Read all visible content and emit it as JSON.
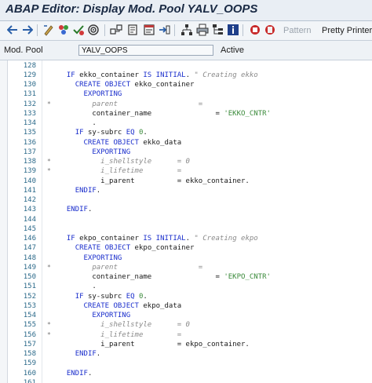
{
  "window": {
    "title": "ABAP Editor: Display Mod. Pool YALV_OOPS"
  },
  "toolbar": {
    "pattern_label": "Pattern",
    "pretty_printer_label": "Pretty Printer"
  },
  "infobar": {
    "label": "Mod. Pool",
    "program": "YALV_OOPS",
    "status": "Active"
  },
  "code_lines": [
    {
      "num": "128",
      "marker": "",
      "segments": []
    },
    {
      "num": "129",
      "marker": "",
      "segments": [
        {
          "t": "  "
        },
        {
          "t": "IF",
          "c": "kw"
        },
        {
          "t": " ekko_container "
        },
        {
          "t": "IS INITIAL",
          "c": "kw"
        },
        {
          "t": ". "
        },
        {
          "t": "\" Creating ekko",
          "c": "cm"
        }
      ]
    },
    {
      "num": "130",
      "marker": "",
      "segments": [
        {
          "t": "    "
        },
        {
          "t": "CREATE OBJECT",
          "c": "kw"
        },
        {
          "t": " ekko_container"
        }
      ]
    },
    {
      "num": "131",
      "marker": "",
      "segments": [
        {
          "t": "      "
        },
        {
          "t": "EXPORTING",
          "c": "kw"
        }
      ]
    },
    {
      "num": "132",
      "marker": "*",
      "segments": [
        {
          "t": "        parent                   =",
          "c": "cm"
        }
      ]
    },
    {
      "num": "133",
      "marker": "",
      "segments": [
        {
          "t": "        container_name               = "
        },
        {
          "t": "'EKKO_CNTR'",
          "c": "st"
        }
      ]
    },
    {
      "num": "134",
      "marker": "",
      "segments": [
        {
          "t": "        ."
        }
      ]
    },
    {
      "num": "135",
      "marker": "",
      "segments": [
        {
          "t": "    "
        },
        {
          "t": "IF",
          "c": "kw"
        },
        {
          "t": " sy-subrc "
        },
        {
          "t": "EQ",
          "c": "kw"
        },
        {
          "t": " "
        },
        {
          "t": "0",
          "c": "st"
        },
        {
          "t": "."
        }
      ]
    },
    {
      "num": "136",
      "marker": "",
      "segments": [
        {
          "t": "      "
        },
        {
          "t": "CREATE OBJECT",
          "c": "kw"
        },
        {
          "t": " ekko_data"
        }
      ]
    },
    {
      "num": "137",
      "marker": "",
      "segments": [
        {
          "t": "        "
        },
        {
          "t": "EXPORTING",
          "c": "kw"
        }
      ]
    },
    {
      "num": "138",
      "marker": "*",
      "segments": [
        {
          "t": "          i_shellstyle      = 0",
          "c": "cm"
        }
      ]
    },
    {
      "num": "139",
      "marker": "*",
      "segments": [
        {
          "t": "          i_lifetime        =",
          "c": "cm"
        }
      ]
    },
    {
      "num": "140",
      "marker": "",
      "segments": [
        {
          "t": "          i_parent          = ekko_container."
        }
      ]
    },
    {
      "num": "141",
      "marker": "",
      "segments": [
        {
          "t": "    "
        },
        {
          "t": "ENDIF",
          "c": "kw"
        },
        {
          "t": "."
        }
      ]
    },
    {
      "num": "142",
      "marker": "",
      "segments": []
    },
    {
      "num": "143",
      "marker": "",
      "segments": [
        {
          "t": "  "
        },
        {
          "t": "ENDIF",
          "c": "kw"
        },
        {
          "t": "."
        }
      ]
    },
    {
      "num": "144",
      "marker": "",
      "segments": []
    },
    {
      "num": "145",
      "marker": "",
      "segments": []
    },
    {
      "num": "146",
      "marker": "",
      "segments": [
        {
          "t": "  "
        },
        {
          "t": "IF",
          "c": "kw"
        },
        {
          "t": " ekpo_container "
        },
        {
          "t": "IS INITIAL",
          "c": "kw"
        },
        {
          "t": ". "
        },
        {
          "t": "\" Creating ekpo",
          "c": "cm"
        }
      ]
    },
    {
      "num": "147",
      "marker": "",
      "segments": [
        {
          "t": "    "
        },
        {
          "t": "CREATE OBJECT",
          "c": "kw"
        },
        {
          "t": " ekpo_container"
        }
      ]
    },
    {
      "num": "148",
      "marker": "",
      "segments": [
        {
          "t": "      "
        },
        {
          "t": "EXPORTING",
          "c": "kw"
        }
      ]
    },
    {
      "num": "149",
      "marker": "*",
      "segments": [
        {
          "t": "        parent                   =",
          "c": "cm"
        }
      ]
    },
    {
      "num": "150",
      "marker": "",
      "segments": [
        {
          "t": "        container_name               = "
        },
        {
          "t": "'EKPO_CNTR'",
          "c": "st"
        }
      ]
    },
    {
      "num": "151",
      "marker": "",
      "segments": [
        {
          "t": "        ."
        }
      ]
    },
    {
      "num": "152",
      "marker": "",
      "segments": [
        {
          "t": "    "
        },
        {
          "t": "IF",
          "c": "kw"
        },
        {
          "t": " sy-subrc "
        },
        {
          "t": "EQ",
          "c": "kw"
        },
        {
          "t": " "
        },
        {
          "t": "0",
          "c": "st"
        },
        {
          "t": "."
        }
      ]
    },
    {
      "num": "153",
      "marker": "",
      "segments": [
        {
          "t": "      "
        },
        {
          "t": "CREATE OBJECT",
          "c": "kw"
        },
        {
          "t": " ekpo_data"
        }
      ]
    },
    {
      "num": "154",
      "marker": "",
      "segments": [
        {
          "t": "        "
        },
        {
          "t": "EXPORTING",
          "c": "kw"
        }
      ]
    },
    {
      "num": "155",
      "marker": "*",
      "segments": [
        {
          "t": "          i_shellstyle      = 0",
          "c": "cm"
        }
      ]
    },
    {
      "num": "156",
      "marker": "*",
      "segments": [
        {
          "t": "          i_lifetime        =",
          "c": "cm"
        }
      ]
    },
    {
      "num": "157",
      "marker": "",
      "segments": [
        {
          "t": "          i_parent          = ekpo_container."
        }
      ]
    },
    {
      "num": "158",
      "marker": "",
      "segments": [
        {
          "t": "    "
        },
        {
          "t": "ENDIF",
          "c": "kw"
        },
        {
          "t": "."
        }
      ]
    },
    {
      "num": "159",
      "marker": "",
      "segments": []
    },
    {
      "num": "160",
      "marker": "",
      "segments": [
        {
          "t": "  "
        },
        {
          "t": "ENDIF",
          "c": "kw"
        },
        {
          "t": "."
        }
      ]
    },
    {
      "num": "161",
      "marker": "",
      "segments": []
    }
  ],
  "colors": {
    "keyword": "#1a2ecc",
    "comment": "#8a8a8a",
    "string": "#3a8a3a",
    "line_number": "#2c6a8a"
  }
}
